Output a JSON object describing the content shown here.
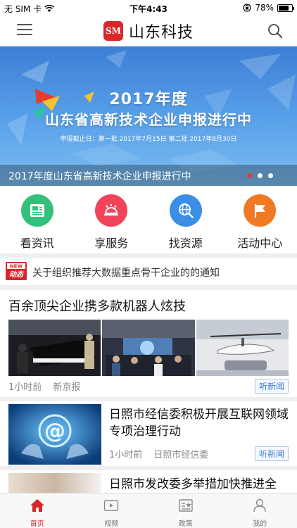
{
  "status_bar": {
    "carrier": "无 SIM 卡",
    "time": "下午4:43",
    "battery": "78%",
    "battery_level": 0.78
  },
  "nav": {
    "title": "山东科技",
    "logo_text": "SM"
  },
  "banner": {
    "year_title": "2017年度",
    "headline": "山东省高新技术企业申报进行中",
    "deadline": "申报截止日：第一批  2017年7月15日   第二批  2017年8月30日",
    "caption": "2017年度山东省高新技术企业申报进行中"
  },
  "quick_links": [
    {
      "label": "看资讯",
      "icon": "news-icon",
      "color": "#34c07a"
    },
    {
      "label": "享服务",
      "icon": "service-bell-icon",
      "color": "#f0445a"
    },
    {
      "label": "找资源",
      "icon": "globe-search-icon",
      "color": "#3a8ee6"
    },
    {
      "label": "活动中心",
      "icon": "flag-icon",
      "color": "#f07a24"
    }
  ],
  "notice": {
    "badge_top": "NEW",
    "badge_bottom": "动态",
    "text": "关于组织推荐大数据重点骨干企业的的通知"
  },
  "news": [
    {
      "title": "百余顶尖企业携多款机器人炫技",
      "time": "1小时前",
      "source": "新京报",
      "listen": "听新闻"
    },
    {
      "title": "日照市经信委积极开展互联网领域专项治理行动",
      "time": "1小时前",
      "source": "日照市经信委",
      "listen": "听新闻"
    },
    {
      "title": "日照市发改委多举措加快推进全"
    }
  ],
  "tabs": [
    {
      "label": "首页",
      "icon": "home-icon"
    },
    {
      "label": "视频",
      "icon": "video-icon"
    },
    {
      "label": "政策",
      "icon": "policy-icon"
    },
    {
      "label": "我的",
      "icon": "user-icon"
    }
  ],
  "colors": {
    "brand_red": "#d8262b",
    "link_blue": "#3a7bd5",
    "banner_blue": "#3c7fd6"
  }
}
